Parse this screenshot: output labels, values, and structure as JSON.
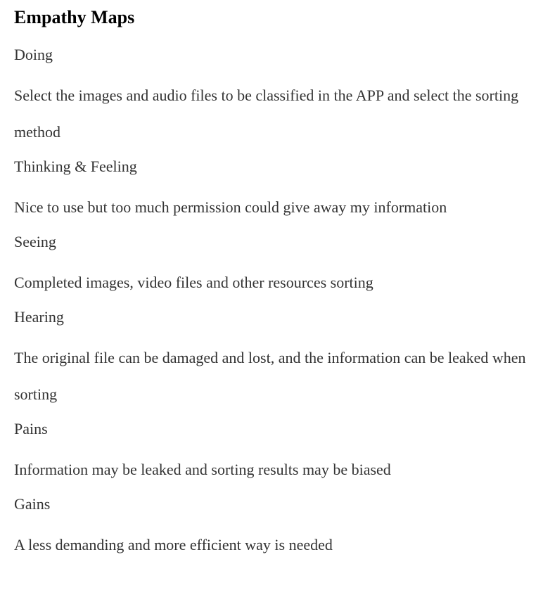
{
  "page": {
    "title": "Empathy Maps"
  },
  "sections": [
    {
      "heading": "Doing",
      "body": "Select the images and audio files to be classified in the APP and select the sorting method"
    },
    {
      "heading": "Thinking & Feeling",
      "body": "Nice to use but too much permission could give away my information"
    },
    {
      "heading": "Seeing",
      "body": "Completed images, video files and other resources sorting"
    },
    {
      "heading": "Hearing",
      "body": "The original file can be damaged and lost, and the information can be leaked when sorting"
    },
    {
      "heading": "Pains",
      "body": "Information may be leaked and sorting results may be biased"
    },
    {
      "heading": "Gains",
      "body": "A less demanding and more efficient way is needed"
    }
  ]
}
